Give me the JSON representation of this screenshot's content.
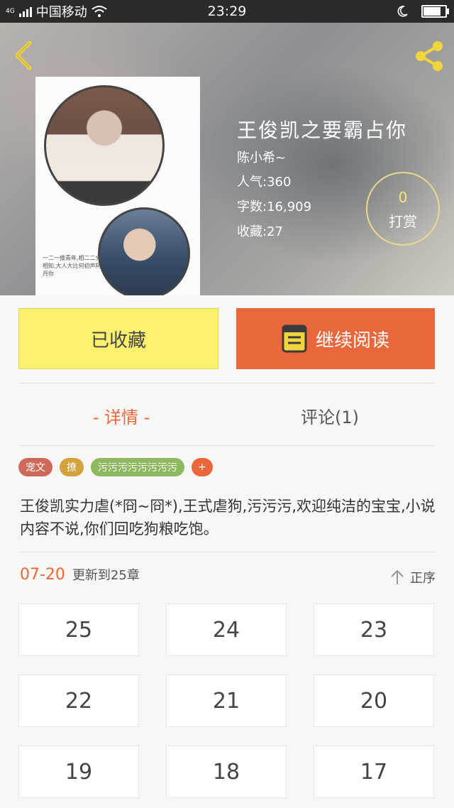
{
  "status_bar": {
    "network": "4G",
    "carrier": "中国移动",
    "time": "23:29"
  },
  "book": {
    "title": "王俊凯之要霸占你",
    "author": "陈小希~",
    "popularity": "人气:360",
    "word_count": "字数:16,909",
    "favorites": "收藏:27",
    "tip_count": "0",
    "tip_label": "打赏"
  },
  "actions": {
    "favorited_label": "已收藏",
    "continue_label": "继续阅读"
  },
  "tabs": {
    "detail": "- 详情 -",
    "comments": "评论(1)"
  },
  "tags": [
    {
      "label": "宠文",
      "color": "#cf6a5a"
    },
    {
      "label": "撩",
      "color": "#d4a23c"
    },
    {
      "label": "污污污污污污污污",
      "color": "#8eb960"
    },
    {
      "label": "+",
      "color": "#e9673a"
    }
  ],
  "description": "王俊凯实力虐(*冏~冏*),王式虐狗,污污污,欢迎纯洁的宝宝,小说内容不说,你们回吃狗粮吃饱。",
  "update": {
    "date": "07-20",
    "text": "更新到25章",
    "order_label": "正序"
  },
  "chapters": [
    "25",
    "24",
    "23",
    "22",
    "21",
    "20",
    "19",
    "18",
    "17"
  ],
  "cover_text": "一二一傻青年,相二二分相知,大人大比何初声阿月你",
  "colors": {
    "accent": "#e9673a",
    "favorite_bg": "#fbf16f",
    "icon_yellow": "#f2d53c"
  }
}
